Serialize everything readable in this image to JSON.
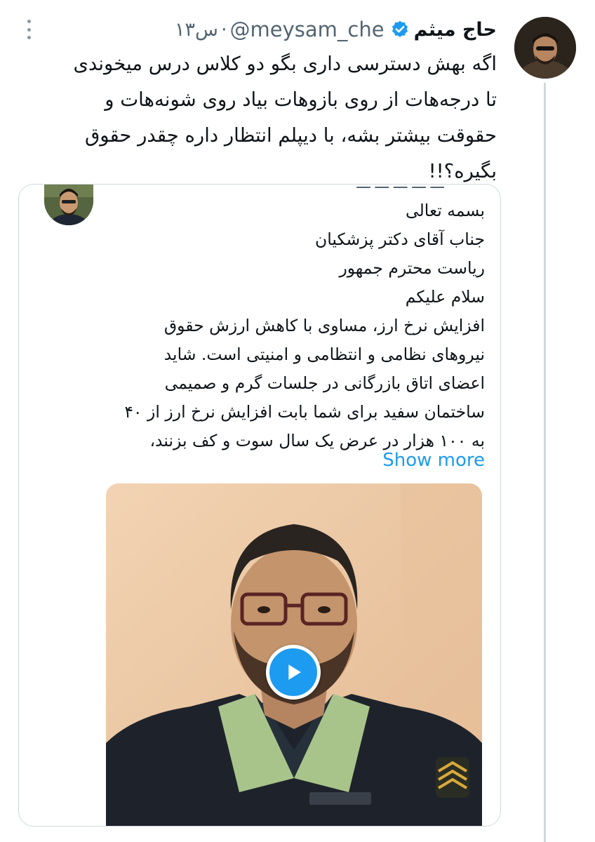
{
  "tweet": {
    "author_name": "حاج میثم",
    "handle": "@meysam_che",
    "separator": "·",
    "time": "۱۳س",
    "text_lines": [
      "اگه بهش دسترسی داری بگو دو کلاس درس میخوندی",
      "تا درجه‌هات از روی بازوهات بیاد روی شونه‌هات و",
      "حقوقت بیشتر بشه، با دیپلم انتظار داره چقدر حقوق",
      "بگیره؟!!"
    ]
  },
  "quote": {
    "greeting": "بسمه تعالی",
    "recipient": "جناب آقای دکتر پزشکیان",
    "title": "ریاست محترم جمهور",
    "salutation": "سلام علیکم",
    "body_lines": [
      "افزایش نرخ ارز، مساوی با کاهش ارزش حقوق",
      "نیروهای نظامی و انتظامی و امنیتی است. شاید",
      "اعضای اتاق بازرگانی در جلسات گرم و صمیمی",
      "ساختمان سفید برای شما بابت افزایش نرخ ارز از ۴۰",
      "به ۱۰۰ هزار در عرض یک سال سوت و کف بزنند،"
    ],
    "show_more": "Show more"
  },
  "icons": {
    "verified": "verified-badge-icon",
    "more": "more-options-icon",
    "play": "play-icon"
  },
  "colors": {
    "accent": "#1d9bf0",
    "text": "#0f1419",
    "secondary": "#536471",
    "border": "#cfd9de"
  }
}
